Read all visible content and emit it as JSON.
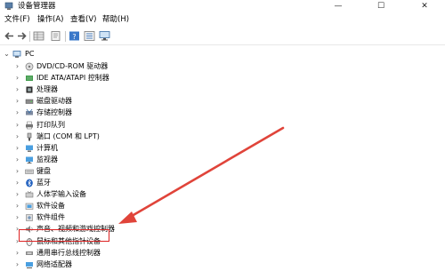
{
  "window": {
    "title": "设备管理器",
    "minimize_glyph": "—",
    "maximize_glyph": "☐",
    "close_glyph": "✕"
  },
  "menu": [
    "文件(F)",
    "操作(A)",
    "查看(V)",
    "帮助(H)"
  ],
  "toolbar": [
    "back-icon",
    "forward-icon",
    "grid-view-icon",
    "properties-icon",
    "help-icon",
    "list-view-icon",
    "monitor-icon"
  ],
  "tree": {
    "root": "PC",
    "items": [
      {
        "label": "DVD/CD-ROM 驱动器",
        "icon": "dvd-drive-icon"
      },
      {
        "label": "IDE ATA/ATAPI 控制器",
        "icon": "ide-controller-icon"
      },
      {
        "label": "处理器",
        "icon": "processor-icon"
      },
      {
        "label": "磁盘驱动器",
        "icon": "disk-drive-icon"
      },
      {
        "label": "存储控制器",
        "icon": "storage-controller-icon"
      },
      {
        "label": "打印队列",
        "icon": "printer-icon"
      },
      {
        "label": "端口 (COM 和 LPT)",
        "icon": "port-icon"
      },
      {
        "label": "计算机",
        "icon": "computer-icon"
      },
      {
        "label": "监视器",
        "icon": "monitor-icon"
      },
      {
        "label": "键盘",
        "icon": "keyboard-icon"
      },
      {
        "label": "蓝牙",
        "icon": "bluetooth-icon"
      },
      {
        "label": "人体学输入设备",
        "icon": "hid-icon"
      },
      {
        "label": "软件设备",
        "icon": "software-device-icon"
      },
      {
        "label": "软件组件",
        "icon": "software-component-icon"
      },
      {
        "label": "声音、视频和游戏控制器",
        "icon": "sound-icon"
      },
      {
        "label": "鼠标和其他指针设备",
        "icon": "mouse-icon",
        "highlighted": true
      },
      {
        "label": "通用串行总线控制器",
        "icon": "usb-icon"
      },
      {
        "label": "网络适配器",
        "icon": "network-adapter-icon"
      }
    ]
  },
  "colors": {
    "highlight": "#dd2222",
    "arrow": "#e0443a"
  }
}
